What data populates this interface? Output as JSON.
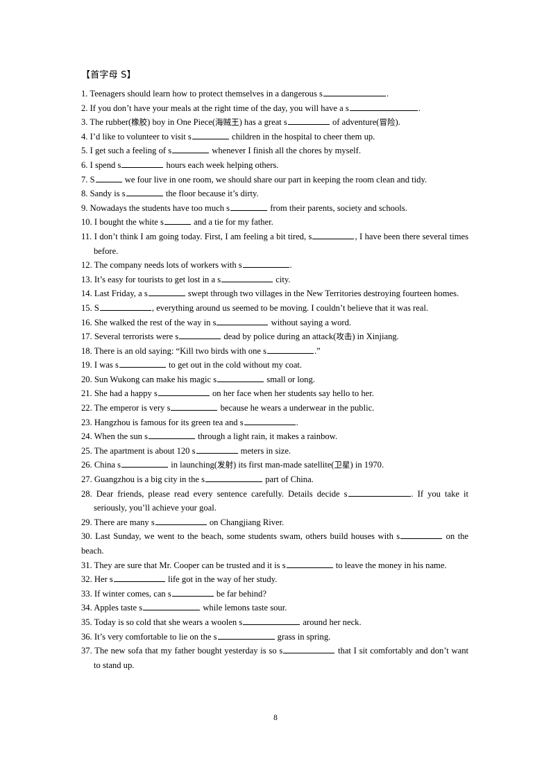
{
  "document": {
    "heading": "【首字母 S】",
    "page_number": "8",
    "items": [
      {
        "number": "1.",
        "text_before": "Teenagers should learn how to protect themselves in a dangerous s",
        "blank": 12,
        "text_after": ".",
        "full_text": "1. Teenagers should learn how to protect themselves in a dangerous s____________."
      },
      {
        "number": "2.",
        "text_before": "If you don’t have your meals at the right time of the day, you will have a s",
        "blank": 13,
        "text_after": ".",
        "full_text": "2. If you don’t have your meals at the right time of the day, you will have a s_____________."
      },
      {
        "number": "3.",
        "text_before": "The rubber(橡胶) boy in One Piece(海贼王) has a great s",
        "blank": 8,
        "text_after": " of adventure(冒险).",
        "full_text": "3. The rubber(橡胶) boy in One Piece(海贼王) has a great s________ of adventure(冒险)."
      },
      {
        "number": "4.",
        "text_before": "I’d like to volunteer to visit s",
        "blank": 7,
        "text_after": " children in the hospital to cheer them up.",
        "full_text": "4. I’d like to volunteer to visit s_______ children in the hospital to cheer them up."
      },
      {
        "number": "5.",
        "text_before": "I get such a feeling of s",
        "blank": 7,
        "text_after": " whenever I finish all the chores by myself.",
        "full_text": "5. I get such a feeling of s_______ whenever I finish all the chores by myself."
      },
      {
        "number": "6.",
        "text_before": "I spend s",
        "blank": 8,
        "text_after": " hours each week helping others.",
        "full_text": "6. I spend s________ hours each week helping others."
      },
      {
        "number": "7.",
        "text_before": "S",
        "blank": 5,
        "text_after": " we four live in one room, we should share our part in keeping the room clean and tidy.",
        "full_text": "7. S_____ we four live in one room, we should share our part in keeping the room clean and tidy."
      },
      {
        "number": "8.",
        "text_before": "Sandy is s",
        "blank": 7,
        "text_after": " the floor because it’s dirty.",
        "full_text": "8. Sandy is s_______ the floor because it’s dirty."
      },
      {
        "number": "9.",
        "text_before": "Nowadays the students have too much s",
        "blank": 7,
        "text_after": " from their parents, society and schools.",
        "full_text": "9. Nowadays the students have too much s_______ from their parents, society and schools."
      },
      {
        "number": "10.",
        "text_before": "I bought the white s",
        "blank": 5,
        "text_after": " and a tie for my father.",
        "full_text": "10. I bought the white s_____ and a tie for my father."
      },
      {
        "number": "11.",
        "text_before": "I don’t think I am going today. First, I am feeling a bit tired, s",
        "blank": 8,
        "text_after": ", I have been there several times before.",
        "full_text": "11. I don’t think I am going today. First, I am feeling a bit tired, s________, I have been there several times before."
      },
      {
        "number": "12.",
        "text_before": "The company needs lots of workers with s",
        "blank": 9,
        "text_after": ".",
        "full_text": "12. The company needs lots of workers with s_________."
      },
      {
        "number": "13.",
        "text_before": "It’s easy for tourists to get lost in a s",
        "blank": 10,
        "text_after": " city.",
        "full_text": "13. It’s easy for tourists to get lost in a s__________ city."
      },
      {
        "number": "14.",
        "text_before": "Last Friday, a s",
        "blank": 7,
        "text_after": " swept through two villages in the New Territories destroying fourteen homes.",
        "full_text": "14. Last Friday, a s_______ swept through two villages in the New Territories destroying fourteen homes."
      },
      {
        "number": "15.",
        "text_before": "S",
        "blank": 10,
        "text_after": ", everything around us seemed to be moving. I couldn’t believe that it was real.",
        "full_text": "15. S__________, everything around us seemed to be moving. I couldn’t believe that it was real."
      },
      {
        "number": "16.",
        "text_before": "She walked the rest of the way in s",
        "blank": 10,
        "text_after": " without saying a word.",
        "full_text": "16. She walked the rest of the way in s__________ without saying a word."
      },
      {
        "number": "17.",
        "text_before": "Several terrorists were s",
        "blank": 8,
        "text_after": " dead by police during an attack(攻击) in Xinjiang.",
        "full_text": "17. Several terrorists were s________ dead by police during an attack(攻击) in Xinjiang."
      },
      {
        "number": "18.",
        "text_before": "There is an old saying: “Kill two birds with one s",
        "blank": 9,
        "text_after": ".”",
        "full_text": "18. There is an old saying: “Kill two birds with one s_________.”"
      },
      {
        "number": "19.",
        "text_before": "I was s",
        "blank": 9,
        "text_after": " to get out in the cold without my coat.",
        "full_text": "19. I was s_________ to get out in the cold without my coat."
      },
      {
        "number": "20.",
        "text_before": "Sun Wukong can make his magic s",
        "blank": 9,
        "text_after": " small or long.",
        "full_text": "20. Sun Wukong can make his magic s_________ small or long."
      },
      {
        "number": "21.",
        "text_before": "She had a happy s",
        "blank": 10,
        "text_after": " on her face when her students say hello to her.",
        "full_text": "21. She had a happy s__________ on her face when her students say hello to her."
      },
      {
        "number": "22.",
        "text_before": "The emperor is very s",
        "blank": 9,
        "text_after": " because he wears a underwear in the public.",
        "full_text": "22. The emperor is very s_________ because he wears a underwear in the public."
      },
      {
        "number": "23.",
        "text_before": "Hangzhou is famous for its green tea and s",
        "blank": 10,
        "text_after": ".",
        "full_text": "23. Hangzhou is famous for its green tea and s__________."
      },
      {
        "number": "24.",
        "text_before": "When the sun s",
        "blank": 9,
        "text_after": " through a light rain, it makes a rainbow.",
        "full_text": "24. When the sun s_________ through a light rain, it makes a rainbow."
      },
      {
        "number": "25.",
        "text_before": "The apartment is about 120 s",
        "blank": 8,
        "text_after": " meters in size.",
        "full_text": "25. The apartment is about 120 s________ meters in size."
      },
      {
        "number": "26.",
        "text_before": "China s",
        "blank": 9,
        "text_after": " in launching(发射) its first man-made satellite(卫星) in 1970.",
        "full_text": "26. China s_________ in launching(发射) its first man-made satellite(卫星) in 1970."
      },
      {
        "number": "27.",
        "text_before": "Guangzhou is a big city in the s",
        "blank": 11,
        "text_after": " part of China.",
        "full_text": "27. Guangzhou is a big city in the s___________ part of China."
      },
      {
        "number": "28.",
        "text_before": "Dear friends, please read every sentence carefully. Details decide s",
        "blank": 12,
        "text_after": ". If you take it seriously, you’ll achieve your goal.",
        "full_text": "28. Dear friends, please read every sentence carefully. Details decide s____________. If you take it seriously, you’ll achieve your goal."
      },
      {
        "number": "29.",
        "text_before": "There are many s",
        "blank": 10,
        "text_after": " on Changjiang River.",
        "full_text": "29. There are many s__________ on Changjiang River."
      },
      {
        "number": "30.",
        "text_before": "Last Sunday, we went to the beach, some students swam, others build houses with s",
        "blank": 8,
        "text_after": " on the beach.",
        "full_text": "30. Last Sunday, we went to the beach, some students swam, others build houses with s________ on the beach."
      },
      {
        "number": "31.",
        "text_before": "They are sure that Mr. Cooper can be trusted and it is s",
        "blank": 9,
        "text_after": " to leave the money in his name.",
        "full_text": "31. They are sure that Mr. Cooper can be trusted and it is s_________ to leave the money in his name."
      },
      {
        "number": "32.",
        "text_before": "Her s",
        "blank": 10,
        "text_after": " life got in the way of her study.",
        "full_text": "32. Her s__________ life got in the way of her study."
      },
      {
        "number": "33.",
        "text_before": "If winter comes, can s",
        "blank": 8,
        "text_after": " be far behind?",
        "full_text": "33. If winter comes, can s________ be far behind?"
      },
      {
        "number": "34.",
        "text_before": "Apples taste s",
        "blank": 11,
        "text_after": " while lemons taste sour.",
        "full_text": "34. Apples taste s___________ while lemons taste sour."
      },
      {
        "number": "35.",
        "text_before": "Today is so cold that she wears a woolen s",
        "blank": 11,
        "text_after": " around her neck.",
        "full_text": "35. Today is so cold that she wears a woolen s___________ around her neck."
      },
      {
        "number": "36.",
        "text_before": "It’s very comfortable to lie on the s",
        "blank": 11,
        "text_after": " grass in spring.",
        "full_text": "36. It’s very comfortable to lie on the s___________ grass in spring."
      },
      {
        "number": "37.",
        "text_before": "The new sofa that my father bought yesterday is so s",
        "blank": 10,
        "text_after": " that I sit comfortably and don’t want to stand up.",
        "full_text": "37. The new sofa that my father bought yesterday is so s__________ that I sit comfortably and don’t want to stand up."
      }
    ]
  }
}
